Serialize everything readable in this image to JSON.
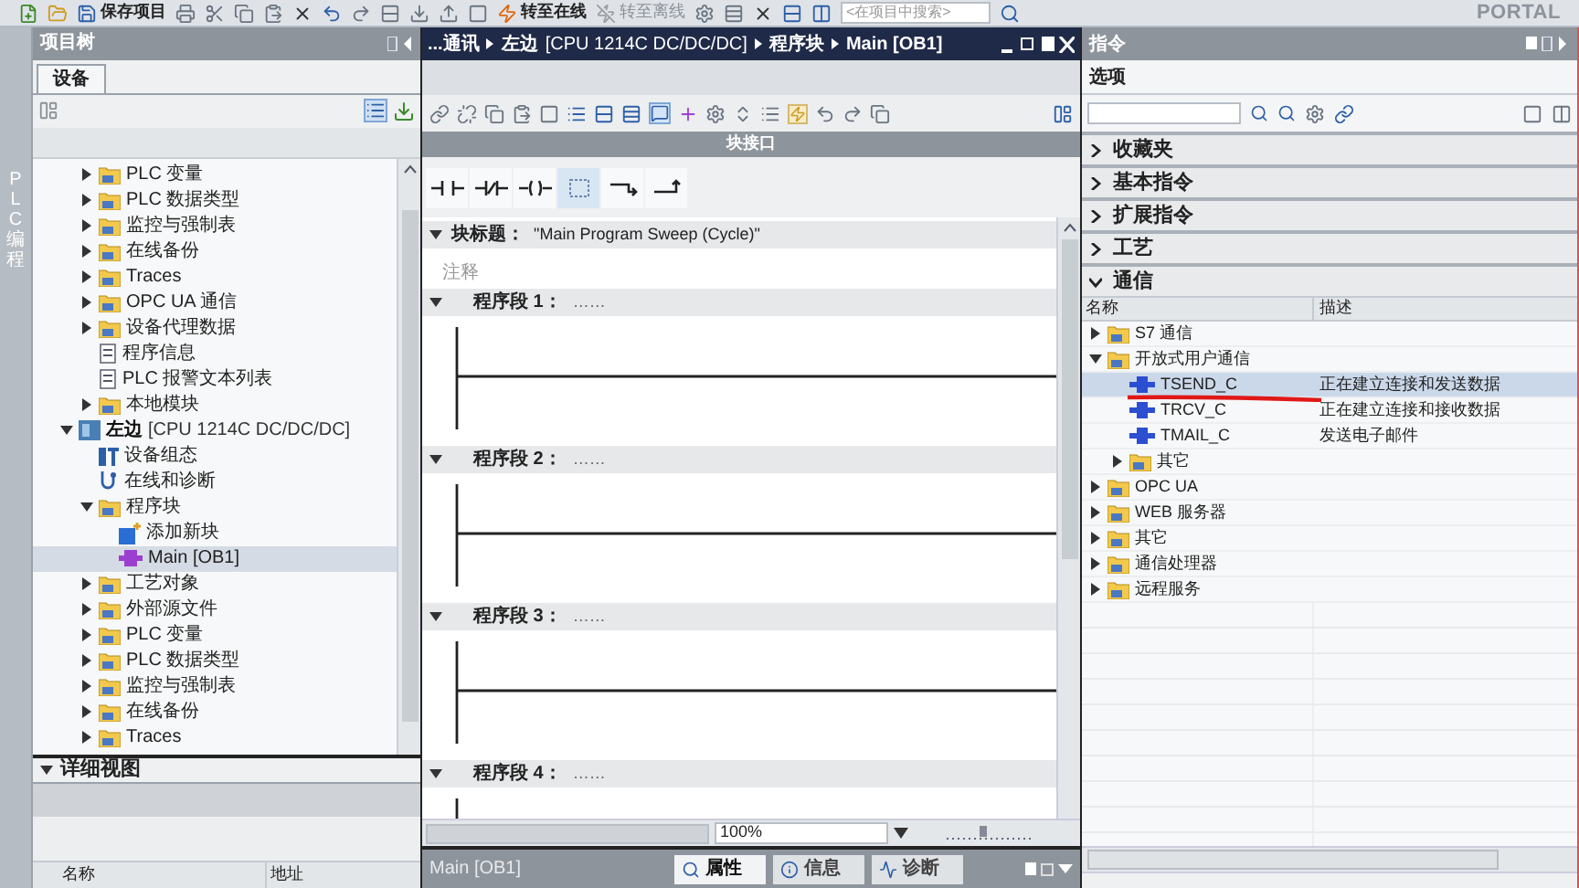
{
  "toolbar": {
    "save_label": "保存项目",
    "go_online": "转至在线",
    "go_offline": "转至离线",
    "search_placeholder": "<在项目中搜索>",
    "brand": "PORTAL"
  },
  "side_strip": {
    "label": "PLC 编程"
  },
  "project_tree": {
    "title": "项目树",
    "tabs": [
      {
        "label": "设备",
        "selected": true
      }
    ],
    "continued_items": [
      {
        "label": "PLC 变量",
        "kind": "folder",
        "expanded": false,
        "selected": false
      },
      {
        "label": "PLC 数据类型",
        "kind": "folder",
        "expanded": false,
        "selected": false
      },
      {
        "label": "监控与强制表",
        "kind": "folder",
        "expanded": false,
        "selected": false
      },
      {
        "label": "在线备份",
        "kind": "folder",
        "expanded": false,
        "selected": false
      },
      {
        "label": "Traces",
        "kind": "folder",
        "expanded": false,
        "selected": false
      },
      {
        "label": "OPC UA 通信",
        "kind": "folder",
        "expanded": false,
        "selected": false
      },
      {
        "label": "设备代理数据",
        "kind": "folder",
        "expanded": false,
        "selected": false
      },
      {
        "label": "程序信息",
        "kind": "document",
        "selected": false
      },
      {
        "label": "PLC 报警文本列表",
        "kind": "document",
        "selected": false
      },
      {
        "label": "本地模块",
        "kind": "folder",
        "expanded": false,
        "selected": false
      }
    ],
    "items": [
      {
        "label": "左边",
        "suffix": "[CPU 1214C DC/DC/DC]",
        "kind": "cpu",
        "expanded": true,
        "selected": false,
        "children": [
          {
            "label": "设备组态",
            "kind": "device",
            "selected": false
          },
          {
            "label": "在线和诊断",
            "kind": "diagnostics",
            "selected": false
          },
          {
            "label": "程序块",
            "kind": "folder",
            "expanded": true,
            "selected": false,
            "children": [
              {
                "label": "添加新块",
                "kind": "add",
                "selected": false
              },
              {
                "label": "Main [OB1]",
                "kind": "block",
                "selected": true
              }
            ]
          },
          {
            "label": "工艺对象",
            "kind": "folder",
            "expanded": false,
            "selected": false
          },
          {
            "label": "外部源文件",
            "kind": "folder",
            "expanded": false,
            "selected": false
          },
          {
            "label": "PLC 变量",
            "kind": "folder",
            "expanded": false,
            "selected": false
          },
          {
            "label": "PLC 数据类型",
            "kind": "folder",
            "expanded": false,
            "selected": false
          },
          {
            "label": "监控与强制表",
            "kind": "folder",
            "expanded": false,
            "selected": false
          },
          {
            "label": "在线备份",
            "kind": "folder",
            "expanded": false,
            "selected": false
          },
          {
            "label": "Traces",
            "kind": "folder",
            "expanded": false,
            "selected": false
          }
        ]
      }
    ]
  },
  "details": {
    "title": "详细视图",
    "expanded": true,
    "columns": [
      "名称",
      "地址"
    ]
  },
  "editor": {
    "breadcrumb": [
      {
        "label": "...通讯"
      },
      {
        "label": "左边",
        "suffix": "[CPU 1214C DC/DC/DC]"
      },
      {
        "label": "程序块"
      },
      {
        "label": "Main [OB1]"
      }
    ],
    "interface_label": "块接口",
    "block_title": {
      "label": "块标题：",
      "value": "\"Main Program Sweep (Cycle)\"",
      "comment": "注释",
      "expanded": true
    },
    "networks": [
      {
        "title": "程序段 1：",
        "comment": "……",
        "expanded": true
      },
      {
        "title": "程序段 2：",
        "comment": "……",
        "expanded": true
      },
      {
        "title": "程序段 3：",
        "comment": "……",
        "expanded": true
      },
      {
        "title": "程序段 4：",
        "comment": "……",
        "expanded": true
      }
    ],
    "zoom": "100%",
    "status": {
      "title": "Main [OB1]",
      "tabs": [
        {
          "label": "属性",
          "selected": true
        },
        {
          "label": "信息",
          "selected": false
        },
        {
          "label": "诊断",
          "selected": false
        }
      ]
    }
  },
  "instructions": {
    "title": "指令",
    "options_label": "选项",
    "sections": [
      {
        "title": "收藏夹",
        "expanded": false
      },
      {
        "title": "基本指令",
        "expanded": false
      },
      {
        "title": "扩展指令",
        "expanded": false
      },
      {
        "title": "工艺",
        "expanded": false
      },
      {
        "title": "通信",
        "expanded": true
      }
    ],
    "columns": [
      "名称",
      "描述"
    ],
    "rows": [
      {
        "name": "S7 通信",
        "kind": "folder",
        "expanded": false,
        "selected": false
      },
      {
        "name": "开放式用户通信",
        "kind": "folder",
        "expanded": true,
        "selected": false,
        "children": [
          {
            "name": "TSEND_C",
            "description": "正在建立连接和发送数据",
            "kind": "instruction",
            "selected": true
          },
          {
            "name": "TRCV_C",
            "description": "正在建立连接和接收数据",
            "kind": "instruction",
            "selected": false
          },
          {
            "name": "TMAIL_C",
            "description": "发送电子邮件",
            "kind": "instruction",
            "selected": false
          },
          {
            "name": "其它",
            "kind": "folder",
            "expanded": false,
            "selected": false
          }
        ]
      },
      {
        "name": "OPC UA",
        "kind": "folder",
        "expanded": false,
        "selected": false
      },
      {
        "name": "WEB 服务器",
        "kind": "folder",
        "expanded": false,
        "selected": false
      },
      {
        "name": "其它",
        "kind": "folder",
        "expanded": false,
        "selected": false
      },
      {
        "name": "通信处理器",
        "kind": "folder",
        "expanded": false,
        "selected": false
      },
      {
        "name": "远程服务",
        "kind": "folder",
        "expanded": false,
        "selected": false
      }
    ]
  }
}
